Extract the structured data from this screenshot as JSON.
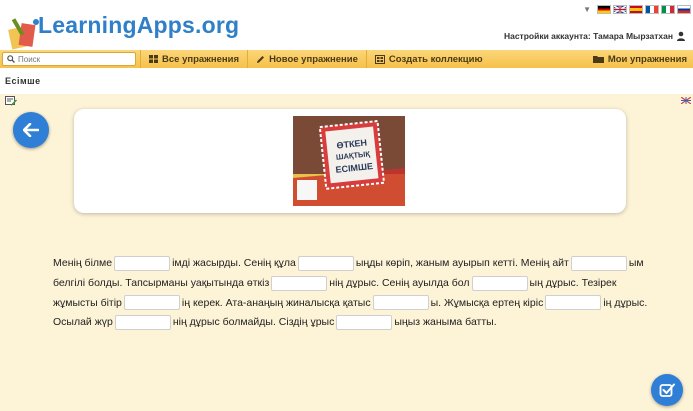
{
  "header": {
    "logo_text": "LearningApps.org",
    "account_label": "Настройки аккаунта: Тамара Мырзатхан",
    "flags": [
      "flag-de-icon",
      "flag-uk-icon",
      "flag-es-icon",
      "flag-fr-icon",
      "flag-it-icon",
      "flag-ru-icon"
    ]
  },
  "nav": {
    "search_placeholder": "Поиск",
    "all_exercises": "Все упражнения",
    "new_exercise": "Новое упражнение",
    "create_collection": "Создать коллекцию",
    "my_exercises": "Мои упражнения"
  },
  "page": {
    "title": "Есімше"
  },
  "card": {
    "image_lines": [
      "ӨТКЕН",
      "ШАҚТЫҚ",
      "ЕСІМШЕ"
    ]
  },
  "exercise": {
    "segments": [
      "Менің білме",
      "імді жасырды. Сенің құла",
      "ыңды көріп, жаным ауырып кетті. Менің айт",
      "ым белгілі болды. Тапсырманы уақытында өткіз",
      "нің дұрыс. Сенің ауылда бол",
      "ың дұрыс. Тезірек жұмысты бітір",
      "ің керек. Ата-анаңың жиналысқа қатыс",
      "ы. Жұмысқа ертең кіріс",
      "ің дұрыс. Осылай жүр",
      "нің дұрыс болмайды. Сіздің ұрыс",
      "ыңыз жаныма батты."
    ]
  },
  "colors": {
    "nav_bg": "#f6c14a",
    "content_bg": "#fdf3d7",
    "accent_blue": "#2f7fd6",
    "logo_blue": "#2f80c8"
  }
}
